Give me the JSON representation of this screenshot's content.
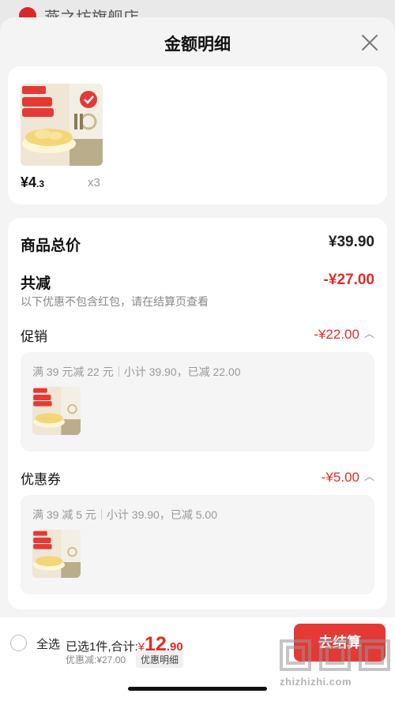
{
  "store": {
    "name": "燕之坊旗舰店"
  },
  "sheet": {
    "title": "金额明细",
    "close_icon": "close-icon"
  },
  "products": [
    {
      "price_main": "¥4",
      "price_decimal": ".3",
      "quantity": "x3"
    }
  ],
  "details": {
    "total_label": "商品总价",
    "total_value": "¥39.90",
    "reduce_label": "共减",
    "reduce_value": "-¥27.00",
    "note": "以下优惠不包含红包，请在结算页查看",
    "promo": {
      "label": "促销",
      "value": "-¥22.00",
      "rule": "满 39 元减 22 元",
      "subtotal": "小计 39.90，已减 22.00"
    },
    "coupon": {
      "label": "优惠券",
      "value": "-¥5.00",
      "rule": "满 39 减 5 元",
      "subtotal": "小计 39.90，已减 5.00"
    }
  },
  "footer": {
    "select_all": "全选",
    "selected_text": "已选1件,合计:",
    "total_yen": "¥",
    "total_int": "12",
    "total_dec": ".90",
    "discount_text": "优惠减:¥27.00",
    "detail_button": "优惠明细",
    "checkout_label": "去结算"
  },
  "watermark": {
    "url": "zhizhizhi.com"
  },
  "colors": {
    "accent_red": "#e02e24",
    "button_red": "#e53935",
    "background": "#f4f4f4"
  }
}
